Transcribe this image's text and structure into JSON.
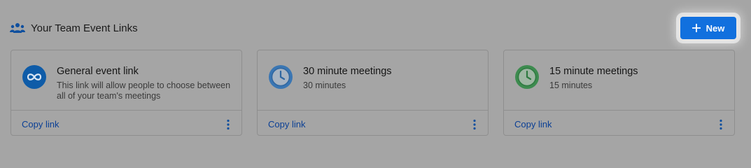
{
  "header": {
    "title": "Your Team Event Links",
    "icon": "team-icon"
  },
  "new_button": {
    "label": "New",
    "icon": "plus-icon",
    "color": "#1170de"
  },
  "cards": [
    {
      "title": "General event link",
      "description": "This link will allow people to choose between all of your team's meetings",
      "icon": "infinity-icon",
      "accent": "#0f5ca8",
      "copy_label": "Copy link"
    },
    {
      "title": "30 minute meetings",
      "description": "30 minutes",
      "icon": "clock-icon",
      "accent": "#3a76b3",
      "copy_label": "Copy link"
    },
    {
      "title": "15 minute meetings",
      "description": "15 minutes",
      "icon": "clock-icon",
      "accent": "#3d8b4f",
      "copy_label": "Copy link"
    }
  ]
}
